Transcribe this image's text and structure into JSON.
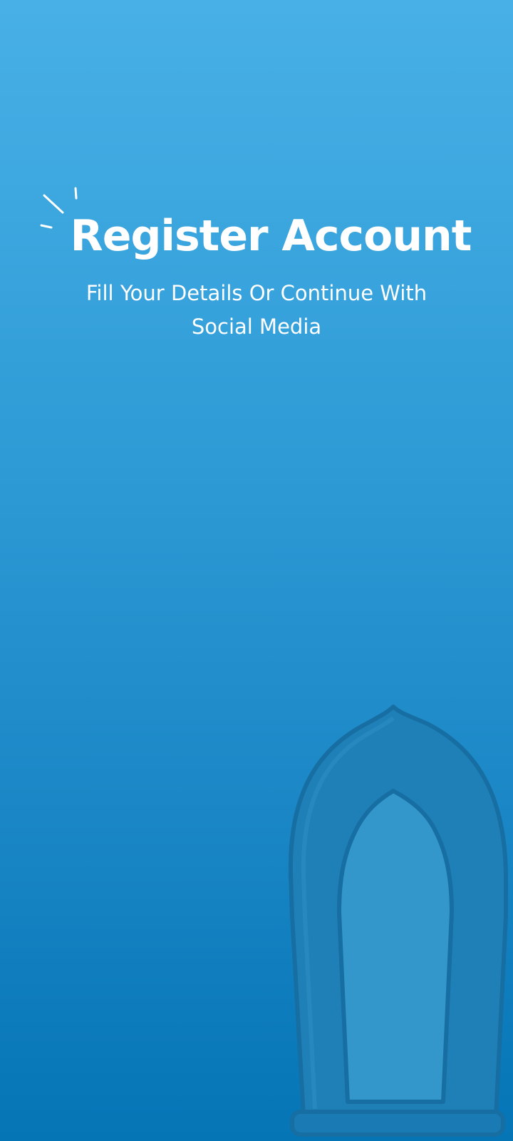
{
  "header": {
    "title": "Register Account",
    "subtitle": "Fill Your Details Or Continue With Social Media"
  },
  "decoration": {
    "sparkle_icon": "sparkle-lines-icon",
    "arch_illustration": "arch-doorway-illustration"
  },
  "colors": {
    "background_top": "#48b0e6",
    "background_bottom": "#0575b6",
    "text": "#ffffff",
    "arch_outer": "#1f80b8",
    "arch_inner": "#3397cb"
  }
}
